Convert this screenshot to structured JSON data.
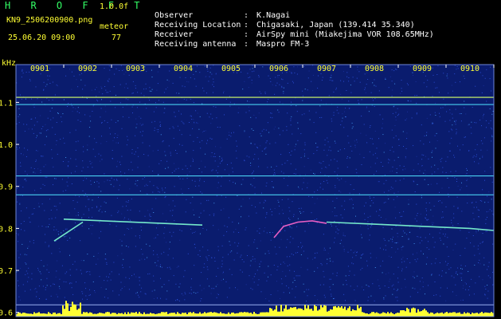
{
  "header": {
    "app_title": "H R O F F T",
    "version": "1.0.0f",
    "filename": "KN9_2506200900.png",
    "meteor_label": "meteor",
    "datetime": "25.06.20 09:00",
    "count": "77"
  },
  "info": [
    {
      "label": "Observer",
      "value": "K.Nagai"
    },
    {
      "label": "Receiving Location",
      "value": "Chigasaki, Japan (139.414 35.340)"
    },
    {
      "label": "Receiver",
      "value": "AirSpy mini (Miakejima VOR 108.65MHz)"
    },
    {
      "label": "Receiving antenna",
      "value": "Maspro FM-3"
    }
  ],
  "colors": {
    "background": "#000000",
    "spectrogram": "#0a1c6e",
    "label_yellow": "#ffff33",
    "title_green": "#33ff66",
    "line_cyan": "#4fe3ff"
  },
  "chart_data": {
    "type": "heatmap",
    "y_unit_label": "kHz",
    "x_ticks": [
      "0901",
      "0902",
      "0903",
      "0904",
      "0905",
      "0906",
      "0907",
      "0908",
      "0909",
      "0910"
    ],
    "y_ticks": [
      "1.1",
      "1.0",
      "0.9",
      "0.8",
      "0.7",
      "0.6"
    ],
    "ylim": [
      0.59,
      1.19
    ],
    "xlim": [
      0,
      10
    ],
    "carrier_lines_khz": [
      1.112,
      1.095,
      0.925,
      0.88,
      0.618
    ],
    "meteor_traces": [
      {
        "x": [
          0.8,
          1.4
        ],
        "y": [
          0.77,
          0.815
        ]
      },
      {
        "x": [
          1.0,
          3.9
        ],
        "y": [
          0.822,
          0.808
        ]
      },
      {
        "x": [
          5.4,
          5.6,
          5.9,
          6.2,
          6.5
        ],
        "y": [
          0.778,
          0.805,
          0.815,
          0.818,
          0.812
        ]
      },
      {
        "x": [
          6.5,
          7.5,
          8.5,
          9.5,
          10.0
        ],
        "y": [
          0.815,
          0.81,
          0.805,
          0.8,
          0.795
        ]
      }
    ]
  }
}
